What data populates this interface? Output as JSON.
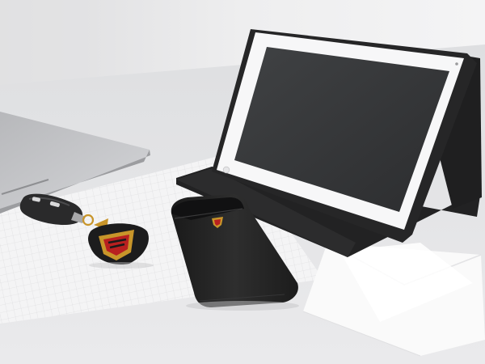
{
  "scene": {
    "kind": "product-photo",
    "items": [
      {
        "name": "laptop",
        "color": "#c9cacd"
      },
      {
        "name": "tablet-in-folio-case",
        "color": "#262626"
      },
      {
        "name": "car-key-fob",
        "color": "#2a2a2a"
      },
      {
        "name": "crest-keychain",
        "color": "#1c1c1c"
      },
      {
        "name": "phone-sleeve",
        "color": "#1f1f1f"
      },
      {
        "name": "paper-notepad",
        "color": "#f4f4f4"
      },
      {
        "name": "white-envelopes",
        "color": "#ffffff"
      }
    ],
    "background_color": "#e9e9eb",
    "accent_color": "#c8952a",
    "crest_red": "#b82020"
  }
}
